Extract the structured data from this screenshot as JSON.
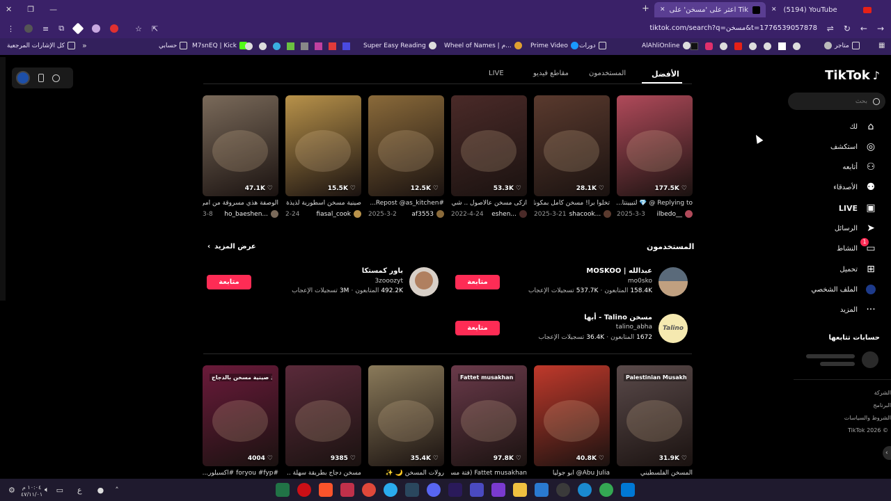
{
  "browser": {
    "tabs": [
      {
        "label": "(5194) YouTube",
        "active": false
      },
      {
        "label": "اعثر على 'مسخن' على TikTok | ب...",
        "active": true
      }
    ],
    "url": "tiktok.com/search?q=مسخن&t=1776539057878",
    "bookmarks": [
      "متاجر",
      "AlAhliOnline",
      "دورات",
      "Prime Video",
      "Wheel of Names | م...",
      "Super Easy Reading",
      "M7snEQ | Kick",
      "حسابي",
      "كل الإشارات المرجعية"
    ]
  },
  "tiktok": {
    "logo": "TikTok",
    "search_placeholder": "بحث",
    "nav": [
      {
        "label": "لك",
        "icon": "home-icon"
      },
      {
        "label": "استكشف",
        "icon": "explore-icon"
      },
      {
        "label": "أتابعه",
        "icon": "following-icon"
      },
      {
        "label": "الأصدقاء",
        "icon": "friends-icon"
      },
      {
        "label": "LIVE",
        "icon": "live-icon"
      },
      {
        "label": "الرسائل",
        "icon": "messages-icon"
      },
      {
        "label": "النشاط",
        "icon": "activity-icon",
        "badge": "1"
      },
      {
        "label": "تحميل",
        "icon": "upload-icon"
      },
      {
        "label": "الملف الشخصي",
        "icon": "profile-icon"
      },
      {
        "label": "المزيد",
        "icon": "more-icon"
      }
    ],
    "following_heading": "حسابات تتابعها",
    "footer_links": [
      "الشركة",
      "البرنامج",
      "الشروط والسياسات",
      "TikTok 2026 ©"
    ],
    "tabs": [
      "الأفضل",
      "المستخدمون",
      "مقاطع فيديو",
      "LIVE"
    ],
    "active_tab": "الأفضل",
    "videos_row1": [
      {
        "likes": "177.5K",
        "caption": "Replying to @ 💎 لتبيينتا...",
        "author": "ilbedo__",
        "date": "2025-3-3",
        "color": "#b04a5a"
      },
      {
        "likes": "28.1K",
        "caption": "تخلوا برا! مسخن كامل بمكونات ...",
        "author": "shacook...",
        "date": "2025-3-21",
        "color": "#5a3a2e"
      },
      {
        "likes": "53.3K",
        "caption": "ازكى مسخن عالأصول .. شي ...",
        "author": "eshen...",
        "date": "2022-4-24",
        "color": "#4a2a28"
      },
      {
        "likes": "12.5K",
        "caption": "#Repost @as_kitchen...",
        "author": "af3553",
        "date": "2025-3-2",
        "color": "#8a6a3a"
      },
      {
        "likes": "15.5K",
        "caption": "صينية مسخن اسطورية لذيذة بشكل ...",
        "author": "fiasal_cook",
        "date": "2-24",
        "color": "#b8924a"
      },
      {
        "likes": "47.1K",
        "caption": "الوصفة هذي مسروقة من امي 🤷",
        "author": "ho_baeshen...",
        "date": "3-8",
        "color": "#7a6a5a"
      }
    ],
    "users_heading": "المستخدمون",
    "see_more": "عرض المزيد",
    "follow_label": "متابعة",
    "users": [
      {
        "name": "عبدالله | MOSKOO",
        "handle": "mo0sko",
        "followers": "158.4K",
        "followers_label": "المتابعون",
        "likes": "537.7K",
        "likes_label": "تسجيلات الإعجاب"
      },
      {
        "name": "باور كمستكا",
        "handle": "3zooozyt",
        "followers": "492.2K",
        "followers_label": "المتابعون",
        "likes": "3M",
        "likes_label": "تسجيلات الإعجاب"
      },
      {
        "name": "مسخن Talino - أبها",
        "handle": "talino_abha",
        "followers": "1672",
        "followers_label": "المتابعون",
        "likes": "36.4K",
        "likes_label": "تسجيلات الإعجاب"
      }
    ],
    "videos_row2": [
      {
        "likes": "31.9K",
        "caption": "المسخن الفلسطيني",
        "overlay": "Palestinian Musakhan",
        "color": "#5a4a4a"
      },
      {
        "likes": "40.8K",
        "caption": "Abu Julia@ أبو جوليا",
        "overlay": "",
        "color": "#c0392b"
      },
      {
        "likes": "97.8K",
        "caption": "Fattet musakhan (فتة مسخ...",
        "overlay": "Fattet musakhan",
        "color": "#6a3a4a"
      },
      {
        "likes": "35.4K",
        "caption": "رولات المسخن 🌙 ✨",
        "overlay": "",
        "color": "#8a7a5a"
      },
      {
        "likes": "9385",
        "caption": "مسخن دجاج بطريقة سهلة .. يحتا...",
        "overlay": "",
        "color": "#5a2a3a"
      },
      {
        "likes": "4004",
        "caption": "#foryou #fyp #اكسبلور...",
        "overlay": "اذ صينية مسخن بالدجاج",
        "color": "#6a1a3a"
      }
    ]
  },
  "taskbar": {
    "time": "١٠:٠٤ م",
    "date": "٤٧/١١/٠١",
    "lang": "ع"
  }
}
